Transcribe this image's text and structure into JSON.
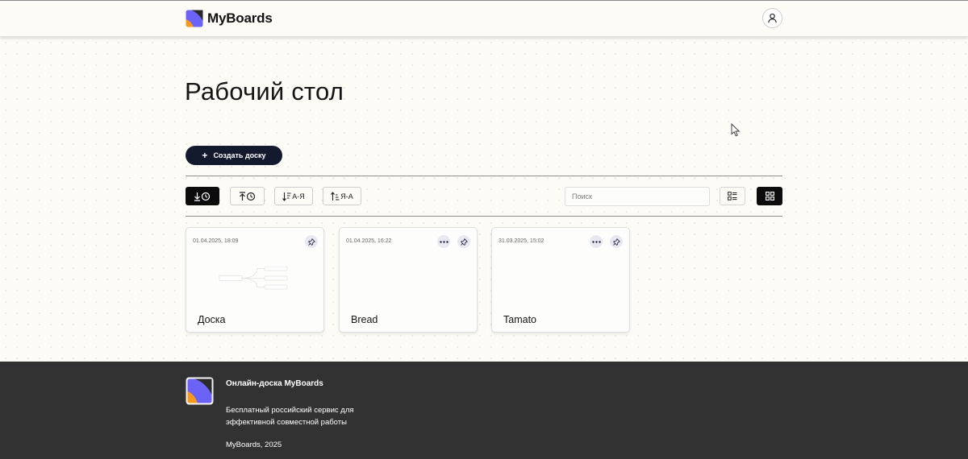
{
  "app": {
    "name": "MyBoards"
  },
  "header": {
    "logo_icon": "myboards-logo",
    "profile_icon": "user-icon"
  },
  "page": {
    "title": "Рабочий стол"
  },
  "toolbar": {
    "create_label": "Создать доску",
    "sort_buttons": [
      {
        "icon": "sort-newest-icon",
        "label": "",
        "active": true
      },
      {
        "icon": "sort-oldest-icon",
        "label": "",
        "active": false
      },
      {
        "icon": "sort-a-z-icon",
        "label": "А-Я",
        "active": false
      },
      {
        "icon": "sort-z-a-icon",
        "label": "Я-А",
        "active": false
      }
    ],
    "search_placeholder": "Поиск",
    "view_modes": [
      {
        "icon": "list-view-icon",
        "active": false
      },
      {
        "icon": "grid-view-icon",
        "active": true
      }
    ]
  },
  "boards": [
    {
      "date": "01.04.2025, 18:09",
      "title": "Доска",
      "has_menu": false,
      "has_preview": true
    },
    {
      "date": "01.04.2025, 16:22",
      "title": "Bread",
      "has_menu": true,
      "has_preview": false
    },
    {
      "date": "31.03.2025, 15:02",
      "title": "Tamato",
      "has_menu": true,
      "has_preview": false
    }
  ],
  "footer": {
    "title": "Онлайн-доска MyBoards",
    "description": "Бесплатный российский сервис для эффективной совместной работы",
    "copyright": "MyBoards, 2025"
  },
  "colors": {
    "background": "#fcfbf6",
    "primary_dark": "#141a2e",
    "footer_bg": "#333232",
    "logo_purple": "#6b63f6",
    "logo_orange": "#f39a1e",
    "icon_circle": "#e7e8f0"
  }
}
